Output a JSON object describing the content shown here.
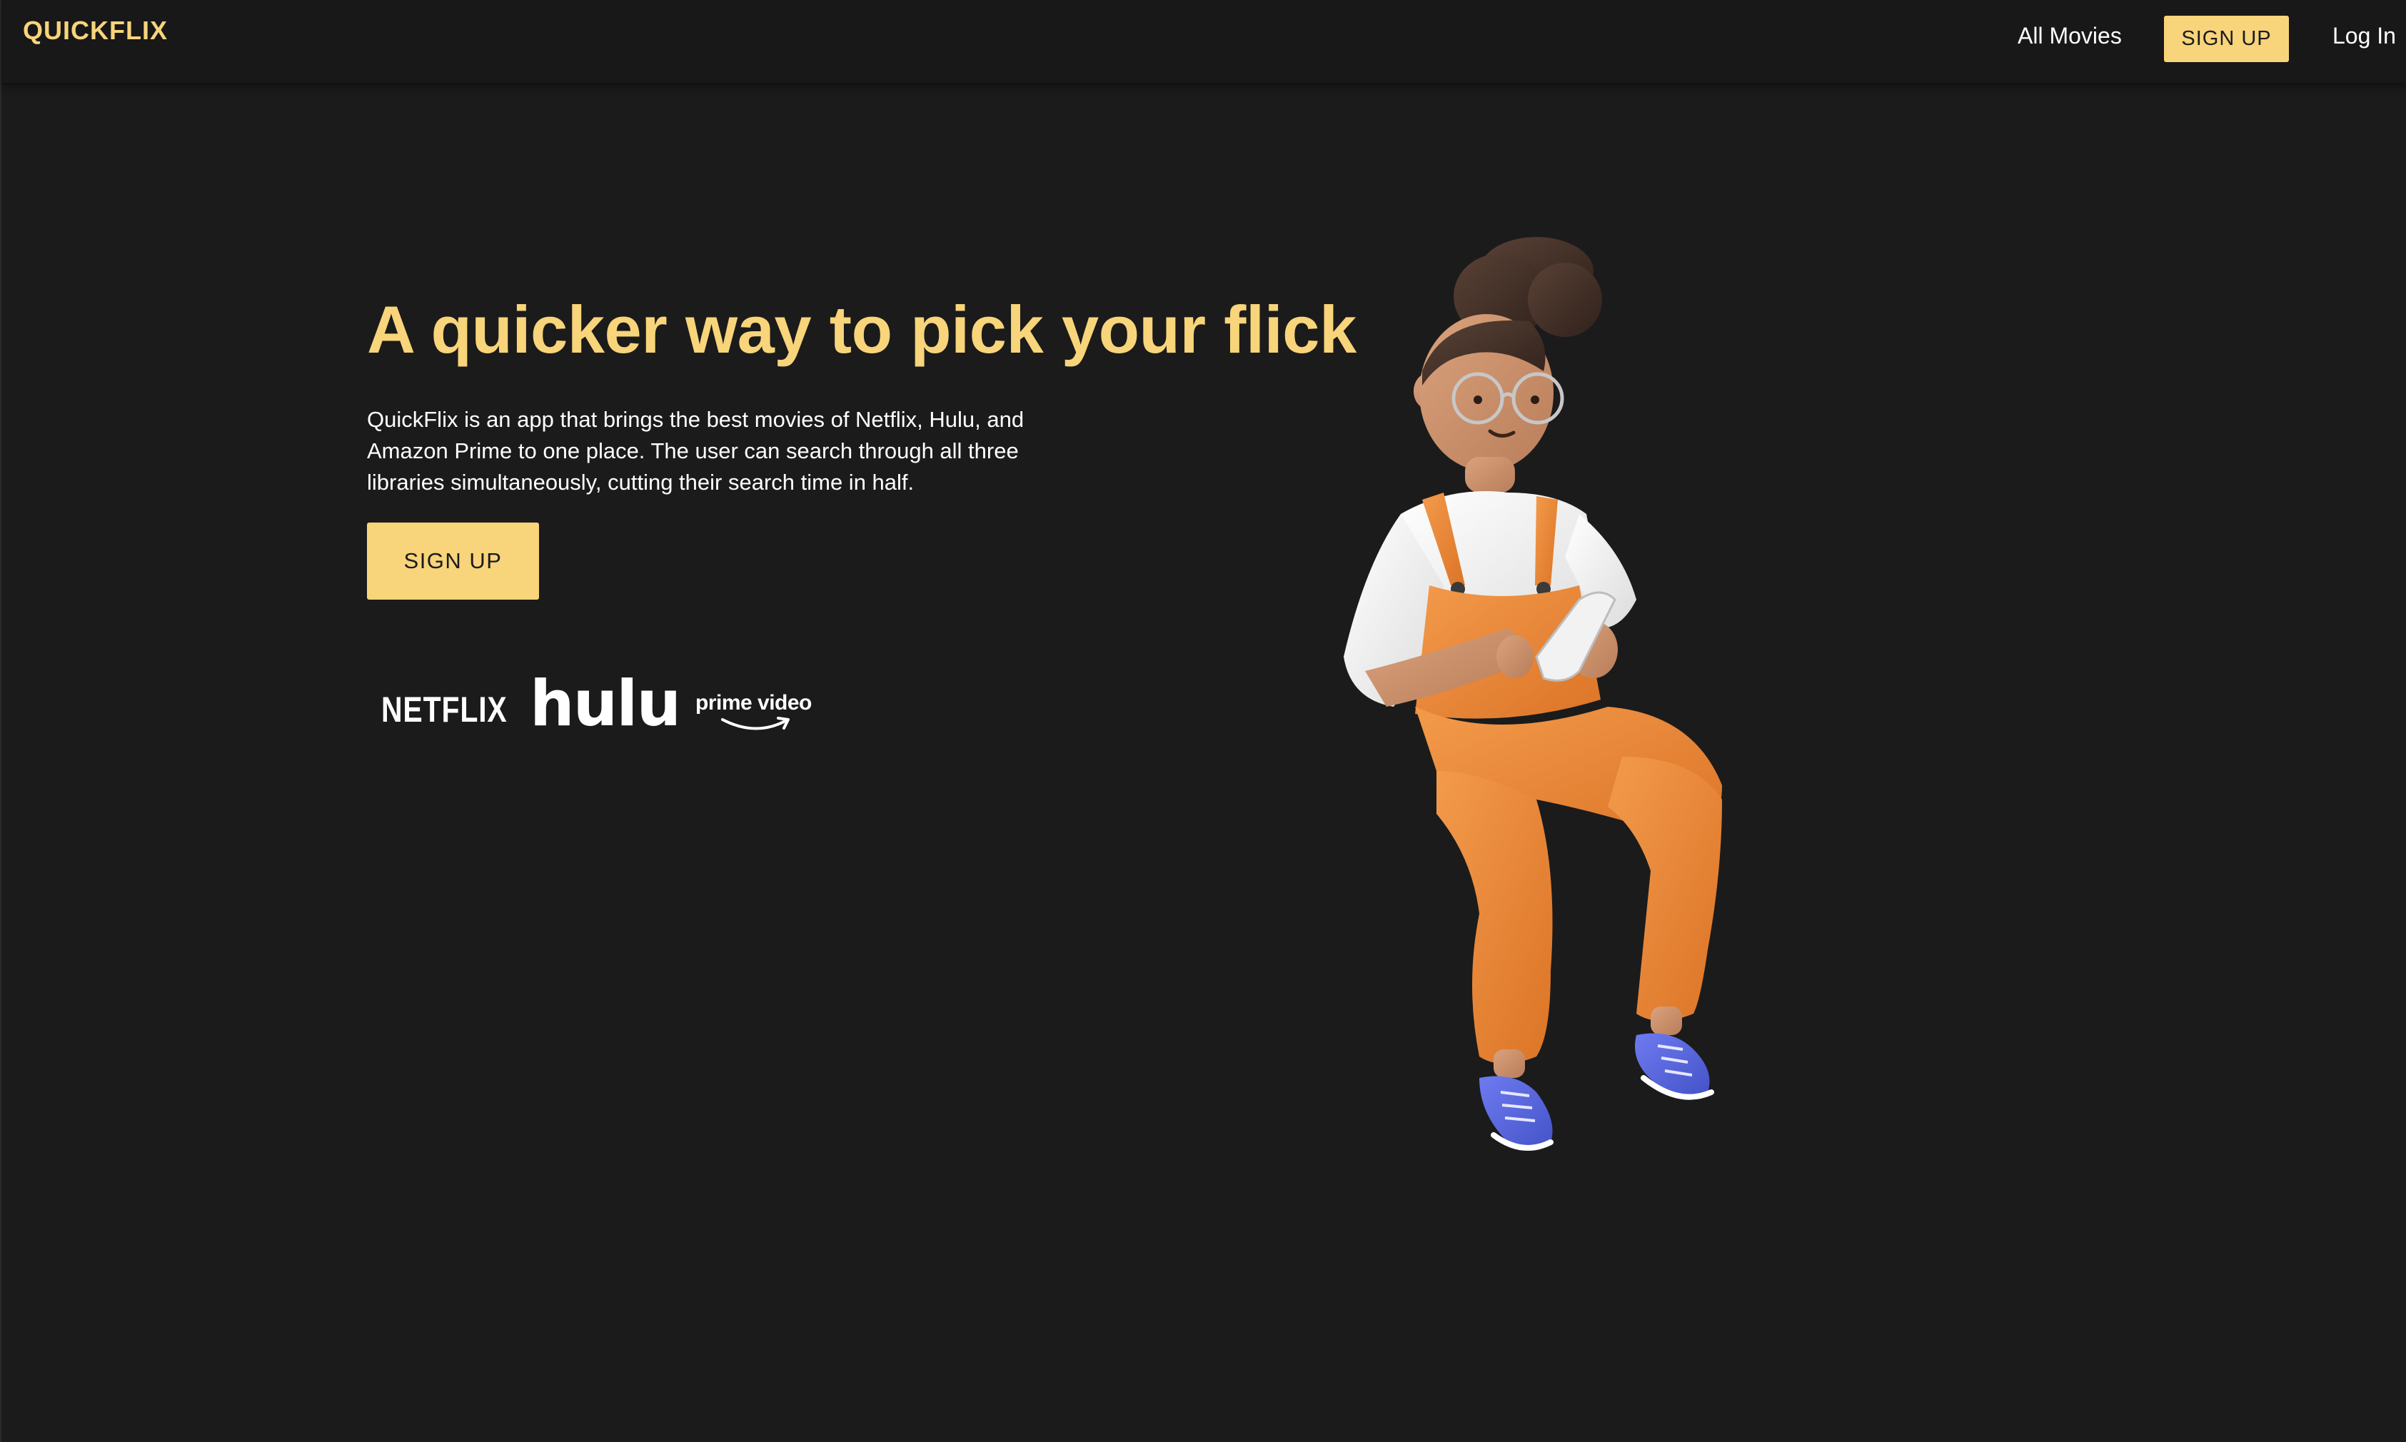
{
  "nav": {
    "brand": "QUICKFLIX",
    "all_movies": "All Movies",
    "signup": "SIGN UP",
    "login": "Log In"
  },
  "hero": {
    "title": "A quicker way to pick your flick",
    "description": "QuickFlix is an app that brings the best movies of Netflix, Hulu, and Amazon Prime to one place. The user can search through all three libraries simultaneously, cutting their search time in half.",
    "signup": "SIGN UP"
  },
  "logos": {
    "netflix": "NETFLIX",
    "hulu": "hulu",
    "prime": "prime video"
  },
  "colors": {
    "background": "#1b1b1b",
    "accent": "#f8d47a",
    "text": "#ffffff"
  }
}
